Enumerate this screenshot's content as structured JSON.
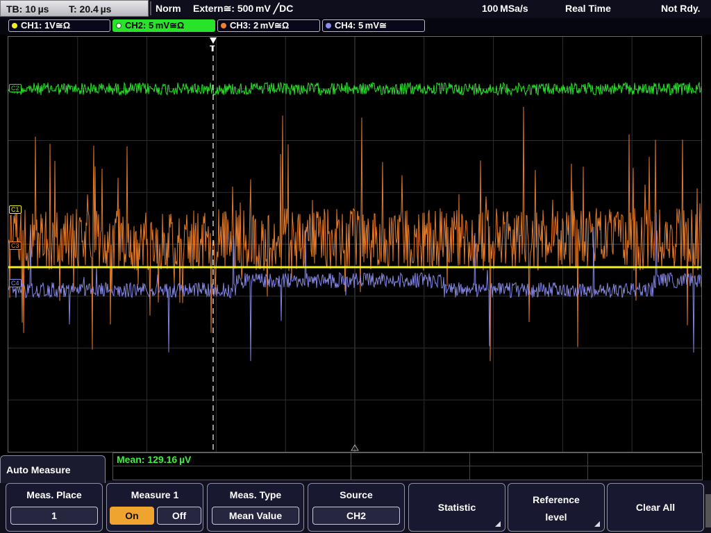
{
  "status_bar": {
    "timebase": "TB: 10 µs",
    "trigger_time": "T: 20.4 µs",
    "trigger_mode": "Norm",
    "trigger_source": "Extern≅: 500 mV ╱DC",
    "sample_rate": "100 MSa/s",
    "acq_mode": "Real Time",
    "state": "Not Rdy."
  },
  "channels": [
    {
      "label": "CH1: 1V≅Ω",
      "color": "#f0f022",
      "active": false
    },
    {
      "label": "CH2: 5 mV≅Ω",
      "color": "#29e22a",
      "active": true
    },
    {
      "label": "CH3: 2 mV≅Ω",
      "color": "#f0822c",
      "active": false
    },
    {
      "label": "CH4: 5 mV≅",
      "color": "#8a8cf0",
      "active": false
    }
  ],
  "trace_labels": {
    "c2": "C2",
    "c1": "C1",
    "c3": "C3",
    "c4": "C4"
  },
  "trigger_marker": "T",
  "measurement": {
    "result": "Mean: 129.16 µV"
  },
  "menu": {
    "title": "Auto Measure",
    "meas_place": {
      "title": "Meas. Place",
      "value": "1"
    },
    "measure1": {
      "title": "Measure 1",
      "on": "On",
      "off": "Off",
      "state": "On"
    },
    "meas_type": {
      "title": "Meas. Type",
      "value": "Mean Value"
    },
    "source": {
      "title": "Source",
      "value": "CH2"
    },
    "statistic": {
      "label": "Statistic"
    },
    "reference": {
      "line1": "Reference",
      "line2": "level"
    },
    "clear_all": {
      "label": "Clear All"
    }
  },
  "colors": {
    "ch1": "#f0f022",
    "ch2": "#29e22a",
    "ch3": "#f0822c",
    "ch4": "#8a8cf0",
    "grid": "#3a3a3a"
  }
}
